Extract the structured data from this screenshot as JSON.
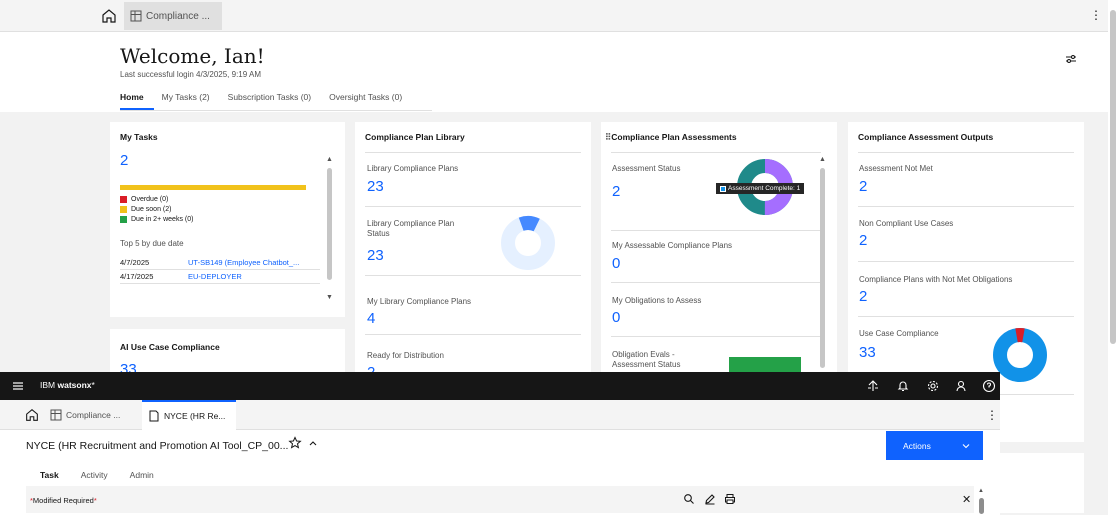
{
  "background_page": {
    "tab_label": "Compliance ...",
    "kebab": "⋮",
    "welcome": "Welcome, Ian!",
    "last_login": "Last successful login 4/3/2025, 9:19 AM",
    "home_tabs": [
      "Home",
      "My Tasks (2)",
      "Subscription Tasks (0)",
      "Oversight Tasks (0)"
    ],
    "my_tasks": {
      "title": "My Tasks",
      "count": "2",
      "bar_color": "#f1c21b",
      "legend": [
        {
          "label": "Overdue (0)",
          "color": "#da1e28"
        },
        {
          "label": "Due soon (2)",
          "color": "#f1c21b"
        },
        {
          "label": "Due in 2+ weeks (0)",
          "color": "#24a148"
        }
      ],
      "top5_label": "Top 5 by due date",
      "rows": [
        {
          "date": "4/7/2025",
          "link": "UT-SB149 (Employee Chatbot_..."
        },
        {
          "date": "4/17/2025",
          "link": "EU-DEPLOYER"
        }
      ]
    },
    "ai_use_case": {
      "title": "AI Use Case Compliance",
      "value": "33"
    },
    "library": {
      "title": "Compliance Plan Library",
      "items": [
        {
          "label": "Library Compliance Plans",
          "value": "23"
        },
        {
          "label": "Library Compliance Plan Status",
          "value": "23"
        },
        {
          "label": "My Library Compliance Plans",
          "value": "4"
        },
        {
          "label": "Ready for Distribution",
          "value": "2"
        }
      ],
      "donut_colors": [
        "#4589ff",
        "#e5f0ff"
      ]
    },
    "assessments": {
      "title": "Compliance Plan Assessments",
      "items": [
        {
          "label": "Assessment Status",
          "value": "2"
        },
        {
          "label": "My Assessable Compliance Plans",
          "value": "0"
        },
        {
          "label": "My Obligations to Assess",
          "value": "0"
        },
        {
          "label": "Obligation Evals - Assessment Status",
          "value": ""
        }
      ],
      "tooltip": "Assessment Complete: 1",
      "donut_colors": [
        "#1f8a8a",
        "#a56eff"
      ],
      "bar_color": "#24a148"
    },
    "outputs": {
      "title": "Compliance Assessment Outputs",
      "items": [
        {
          "label": "Assessment Not Met",
          "value": "2"
        },
        {
          "label": "Non Compliant Use Cases",
          "value": "2"
        },
        {
          "label": "Compliance Plans with Not Met Obligations",
          "value": "2"
        },
        {
          "label": "Use Case Compliance",
          "value": "33"
        }
      ],
      "donut_colors": [
        "#1192e8",
        "#da1e28"
      ]
    }
  },
  "foreground": {
    "brand_prefix": "IBM ",
    "brand_name": "watsonx",
    "brand_suffix": "*",
    "tabs": [
      {
        "label": "Compliance ..."
      },
      {
        "label": "NYCE (HR Re..."
      }
    ],
    "kebab": "⋮",
    "doc_title": "NYCE (HR Recruitment and Promotion AI Tool_CP_00...",
    "actions_label": "Actions",
    "sub_tabs": [
      "Task",
      "Activity",
      "Admin"
    ],
    "modified_label": "Modified",
    "required_label": "Required",
    "asterisk": "*",
    "close": "✕"
  }
}
